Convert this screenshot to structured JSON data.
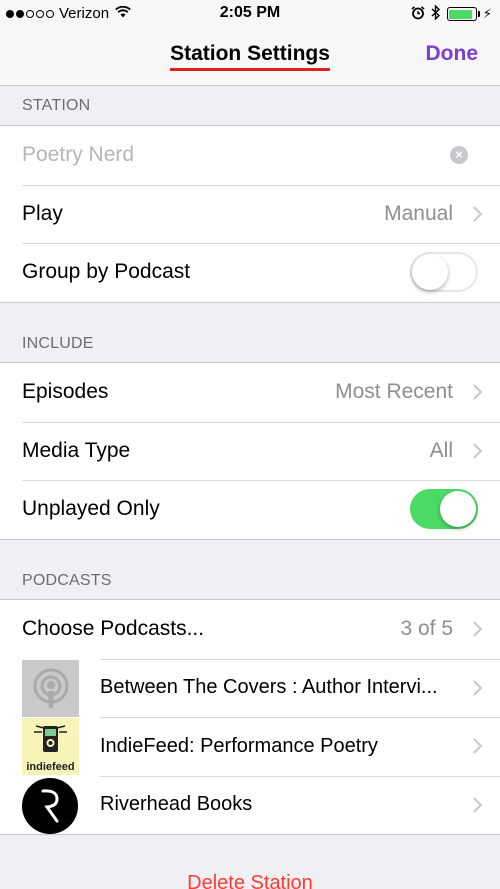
{
  "status_bar": {
    "carrier": "Verizon",
    "time": "2:05 PM",
    "battery_level": 0.9
  },
  "nav": {
    "title": "Station Settings",
    "done_label": "Done"
  },
  "colors": {
    "accent": "#7b3fd1",
    "toggle_on": "#4cd964",
    "destructive": "#ff3b30",
    "annotation_underline": "#e0201e"
  },
  "station": {
    "header": "STATION",
    "name_placeholder": "Poetry Nerd",
    "play_label": "Play",
    "play_value": "Manual",
    "group_label": "Group by Podcast",
    "group_on": false
  },
  "include": {
    "header": "INCLUDE",
    "episodes_label": "Episodes",
    "episodes_value": "Most Recent",
    "media_label": "Media Type",
    "media_value": "All",
    "unplayed_label": "Unplayed Only",
    "unplayed_on": true
  },
  "podcasts": {
    "header": "PODCASTS",
    "choose_label": "Choose Podcasts...",
    "choose_value": "3 of 5",
    "items": [
      {
        "title": "Between The Covers : Author Intervi...",
        "art": "podcast-generic-icon"
      },
      {
        "title": "IndieFeed: Performance Poetry",
        "art": "indiefeed-logo",
        "art_text": "indiefeed"
      },
      {
        "title": "Riverhead Books",
        "art": "riverhead-logo"
      }
    ]
  },
  "delete_label": "Delete Station"
}
